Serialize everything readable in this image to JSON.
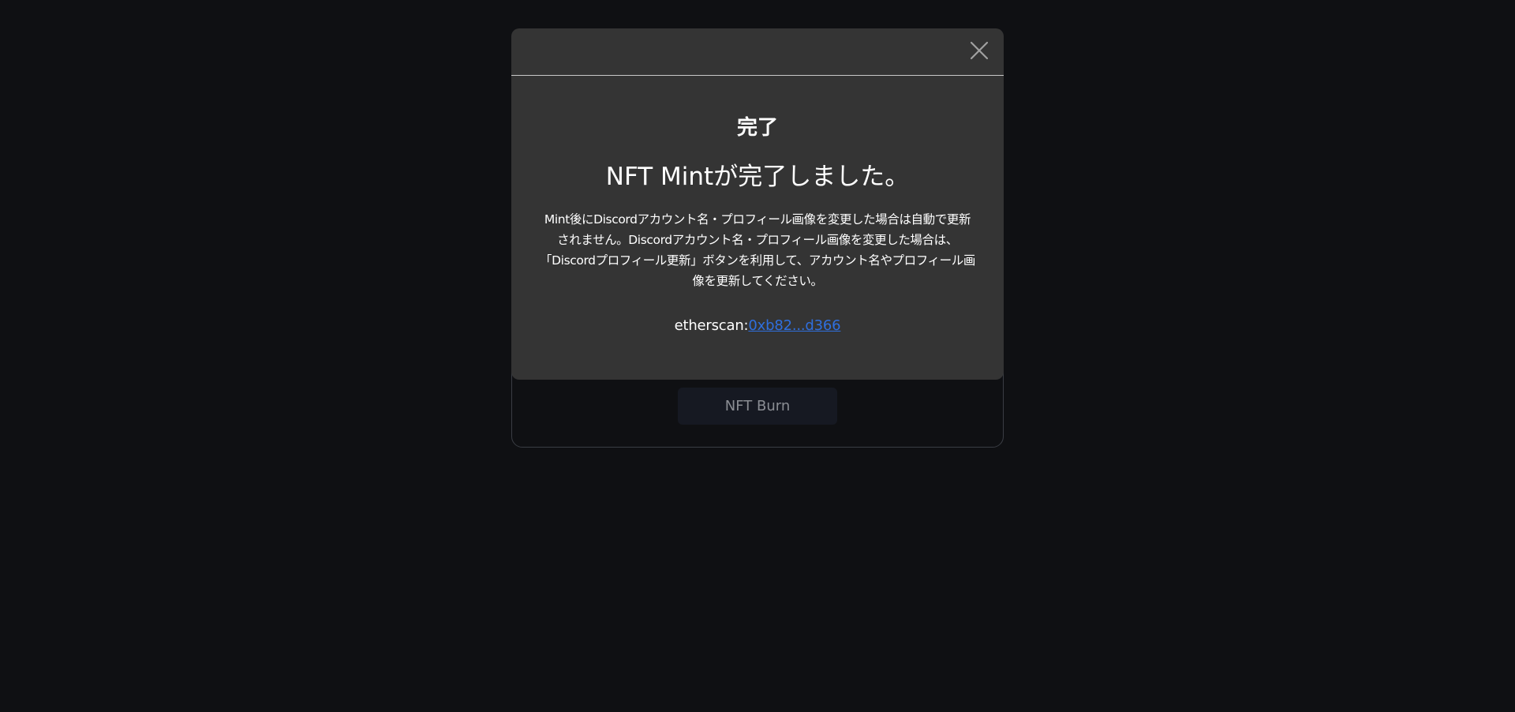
{
  "background_card": {
    "button_label": "NFT Burn"
  },
  "modal": {
    "title": "完了",
    "headline": "NFT Mintが完了しました。",
    "notice": "Mint後にDiscordアカウント名・プロフィール画像を変更した場合は自動で更新されません。Discordアカウント名・プロフィール画像を変更した場合は、「Discordプロフィール更新」ボタンを利用して、アカウント名やプロフィール画像を更新してください。",
    "etherscan_label": "etherscan:",
    "etherscan_link_text": "0xb82...d366",
    "close_icon": "close-icon"
  },
  "colors": {
    "page_background": "#0f1013",
    "modal_background": "#343434",
    "link": "#2f6fde",
    "burn_button_background": "#161922"
  }
}
